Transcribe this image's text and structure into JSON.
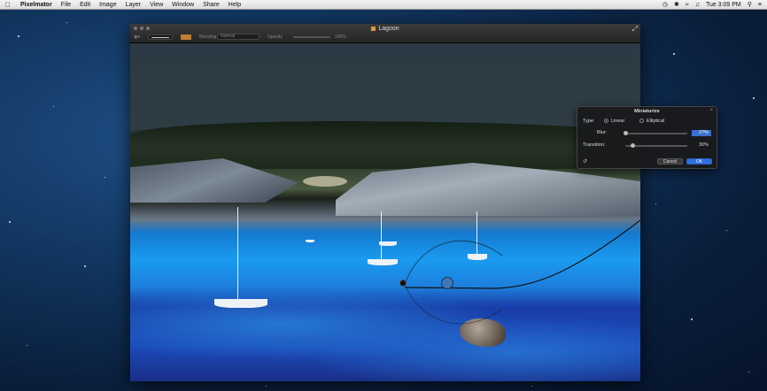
{
  "menubar": {
    "app_name": "Pixelmator",
    "items": [
      "File",
      "Edit",
      "Image",
      "Layer",
      "View",
      "Window",
      "Share",
      "Help"
    ],
    "clock": "Tue 3:09 PM"
  },
  "window": {
    "title": "Lagoon",
    "toolbar": {
      "blending_label": "Blending",
      "blending_value": "Normal",
      "opacity_label": "Opacity",
      "opacity_value": "100%"
    }
  },
  "panel": {
    "title": "Miniaturize",
    "type_label": "Type:",
    "type_options": [
      "Linear",
      "Elliptical"
    ],
    "type_selected": "Linear",
    "blur_label": "Blur:",
    "blur_value": "27%",
    "transition_label": "Transition:",
    "transition_value": "30%",
    "cancel_label": "Cancel",
    "ok_label": "OK"
  },
  "colors": {
    "accent": "#2f6fe0",
    "menubar": "#e8e8e8"
  }
}
